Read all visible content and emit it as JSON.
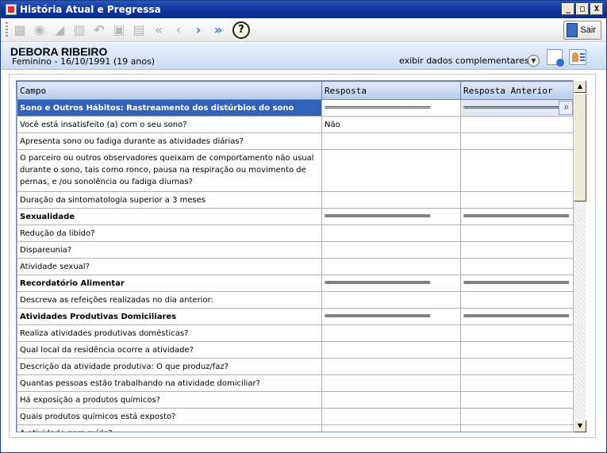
{
  "window": {
    "title": "História Atual e Pregressa",
    "buttons": {
      "minimize": "_",
      "maximize": "□",
      "close": "X"
    }
  },
  "toolbar": {
    "icons": [
      "new-icon",
      "binoculars-icon",
      "eraser-icon",
      "trash-icon",
      "undo-icon",
      "save-icon",
      "print-icon",
      "first-icon",
      "prev-icon",
      "next-icon",
      "last-icon",
      "help-icon"
    ],
    "help_label": "?",
    "exit_label": "Sair"
  },
  "patient": {
    "name": "DEBORA RIBEIRO",
    "info": "Feminino - 16/10/1991 (19 anos)",
    "extra_link": "exibir dados complementares..."
  },
  "grid": {
    "columns": [
      "Campo",
      "Resposta",
      "Resposta Anterior"
    ],
    "separator_value": "==============================",
    "rows": [
      {
        "campo": "Sono e Outros Hábitos: Rastreamento dos distúrbios do sono",
        "resposta": "==============================",
        "anterior": "==============================",
        "type": "selected"
      },
      {
        "campo": "Você está insatisfeito (a) com o seu sono?",
        "resposta": "Não",
        "anterior": "",
        "type": "normal"
      },
      {
        "campo": "Apresenta sono ou fadiga durante as atividades diárias?",
        "resposta": "",
        "anterior": "",
        "type": "normal"
      },
      {
        "campo": "O parceiro ou outros observadores queixam de comportamento não usual durante o sono, tais como ronco, pausa na respiração ou movimento de pernas, e /ou sonolência ou fadiga diurnas?",
        "resposta": "",
        "anterior": "",
        "type": "wrap"
      },
      {
        "campo": "Duração da sintomatologia superior a 3 meses",
        "resposta": "",
        "anterior": "",
        "type": "normal"
      },
      {
        "campo": "Sexualidade",
        "resposta": "==============================",
        "anterior": "==============================",
        "type": "section"
      },
      {
        "campo": "Redução da libido?",
        "resposta": "",
        "anterior": "",
        "type": "normal"
      },
      {
        "campo": "Dispareunia?",
        "resposta": "",
        "anterior": "",
        "type": "normal"
      },
      {
        "campo": "Atividade sexual?",
        "resposta": "",
        "anterior": "",
        "type": "normal"
      },
      {
        "campo": "Recordatório Alimentar",
        "resposta": "==============================",
        "anterior": "==============================",
        "type": "section"
      },
      {
        "campo": "Descreva as refeições realizadas no dia anterior:",
        "resposta": "",
        "anterior": "",
        "type": "normal"
      },
      {
        "campo": "Atividades Produtivas Domiciliares",
        "resposta": "==============================",
        "anterior": "==============================",
        "type": "section"
      },
      {
        "campo": "Realiza atividades produtivas domésticas?",
        "resposta": "",
        "anterior": "",
        "type": "normal"
      },
      {
        "campo": "Qual local da residência ocorre a atividade?",
        "resposta": "",
        "anterior": "",
        "type": "normal"
      },
      {
        "campo": "Descrição da atividade produtiva: O que produz/faz?",
        "resposta": "",
        "anterior": "",
        "type": "normal"
      },
      {
        "campo": "Quantas pessoas estão trabalhando na atividade domiciliar?",
        "resposta": "",
        "anterior": "",
        "type": "normal"
      },
      {
        "campo": "Há exposição a produtos químicos?",
        "resposta": "",
        "anterior": "",
        "type": "normal"
      },
      {
        "campo": "Quais produtos químicos está exposto?",
        "resposta": "",
        "anterior": "",
        "type": "normal"
      },
      {
        "campo": "A atividade gera ruído?",
        "resposta": "",
        "anterior": "",
        "type": "normal"
      }
    ]
  },
  "scrollbar": {
    "up": "▲",
    "down": "▼"
  },
  "colors": {
    "titlebar": "#10379c",
    "selected_row": "#2f62b8",
    "header": "#b7cdec"
  }
}
